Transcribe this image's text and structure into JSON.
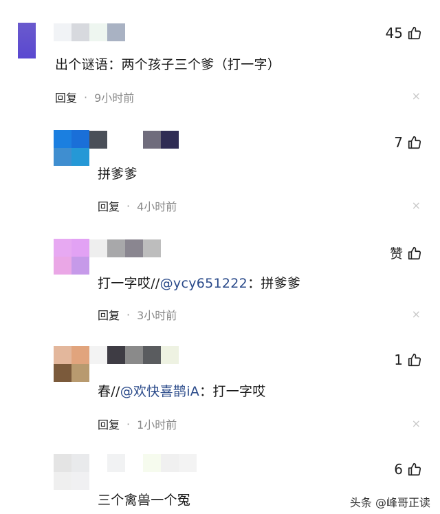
{
  "comments": [
    {
      "text": "出个谜语：两个孩子三个爹（打一字）",
      "reply_label": "回复",
      "dot": "·",
      "time": "9小时前",
      "likes": "45",
      "close": "×"
    },
    {
      "text": "拼爹爹",
      "reply_label": "回复",
      "dot": "·",
      "time": "4小时前",
      "likes": "7",
      "close": "×"
    },
    {
      "text_prefix": "打一字哎//",
      "mention": "@ycy651222",
      "text_suffix": "：拼爹爹",
      "reply_label": "回复",
      "dot": "·",
      "time": "3小时前",
      "likes": "赞",
      "close": "×"
    },
    {
      "text_prefix": "春//",
      "mention": "@欢快喜鹊iA",
      "text_suffix": "：打一字哎",
      "reply_label": "回复",
      "dot": "·",
      "time": "1小时前",
      "likes": "1",
      "close": "×"
    },
    {
      "text": "三个禽兽一个冤",
      "likes": "6"
    }
  ],
  "watermark": "头条 @峰哥正读",
  "colors": {
    "mention": "#2a4a8a",
    "muted": "#888888"
  }
}
